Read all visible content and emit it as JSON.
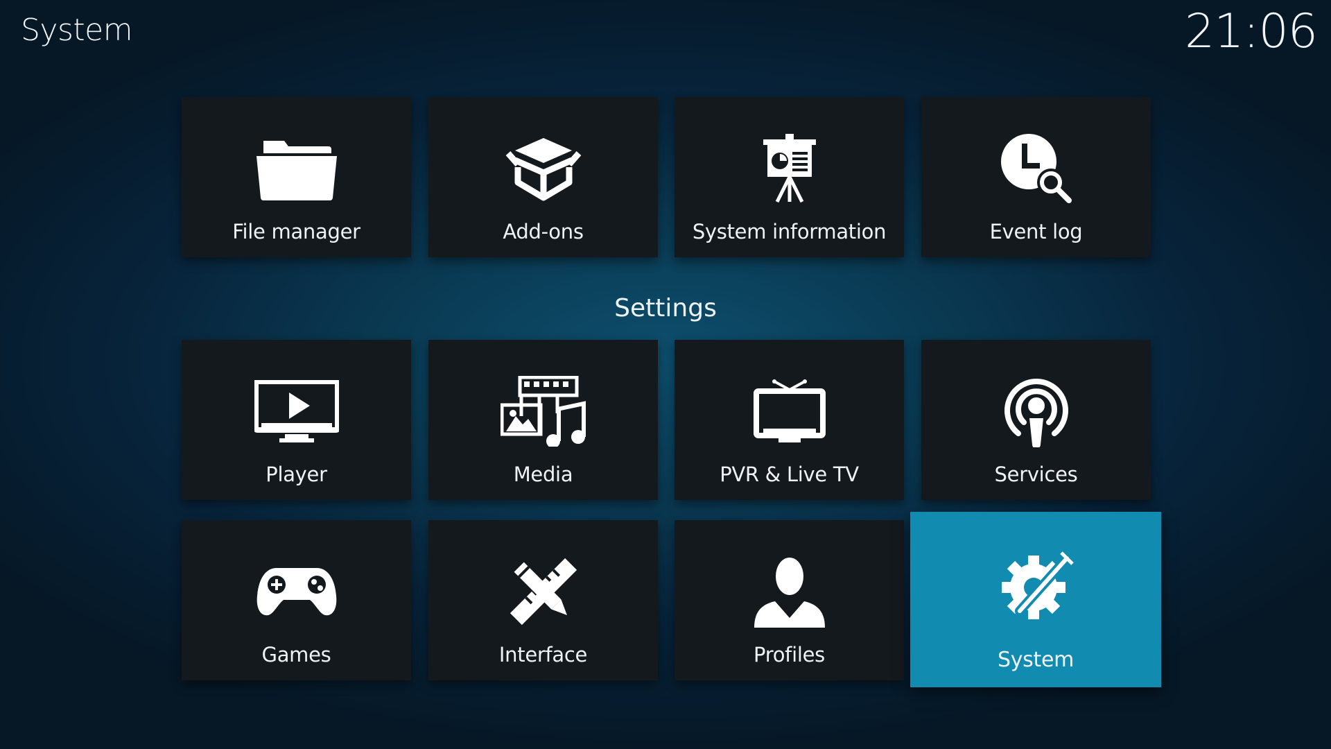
{
  "header": {
    "title": "System",
    "clock": "21:06"
  },
  "settings_section": {
    "label": "Settings"
  },
  "top_tiles": [
    {
      "label": "File manager",
      "icon": "folder-icon"
    },
    {
      "label": "Add-ons",
      "icon": "box-icon"
    },
    {
      "label": "System information",
      "icon": "presentation-easel-icon"
    },
    {
      "label": "Event log",
      "icon": "clock-search-icon"
    }
  ],
  "settings_tiles": [
    {
      "label": "Player",
      "icon": "monitor-play-icon"
    },
    {
      "label": "Media",
      "icon": "media-film-music-icon"
    },
    {
      "label": "PVR & Live TV",
      "icon": "tv-antenna-icon"
    },
    {
      "label": "Services",
      "icon": "broadcast-podcast-icon"
    },
    {
      "label": "Games",
      "icon": "gamepad-icon"
    },
    {
      "label": "Interface",
      "icon": "pencil-ruler-icon"
    },
    {
      "label": "Profiles",
      "icon": "user-icon"
    },
    {
      "label": "System",
      "icon": "gear-tools-icon",
      "focused": true
    }
  ],
  "colors": {
    "tile_background": "#14191e",
    "focus_accent": "#128bb1",
    "text": "#ffffff"
  }
}
